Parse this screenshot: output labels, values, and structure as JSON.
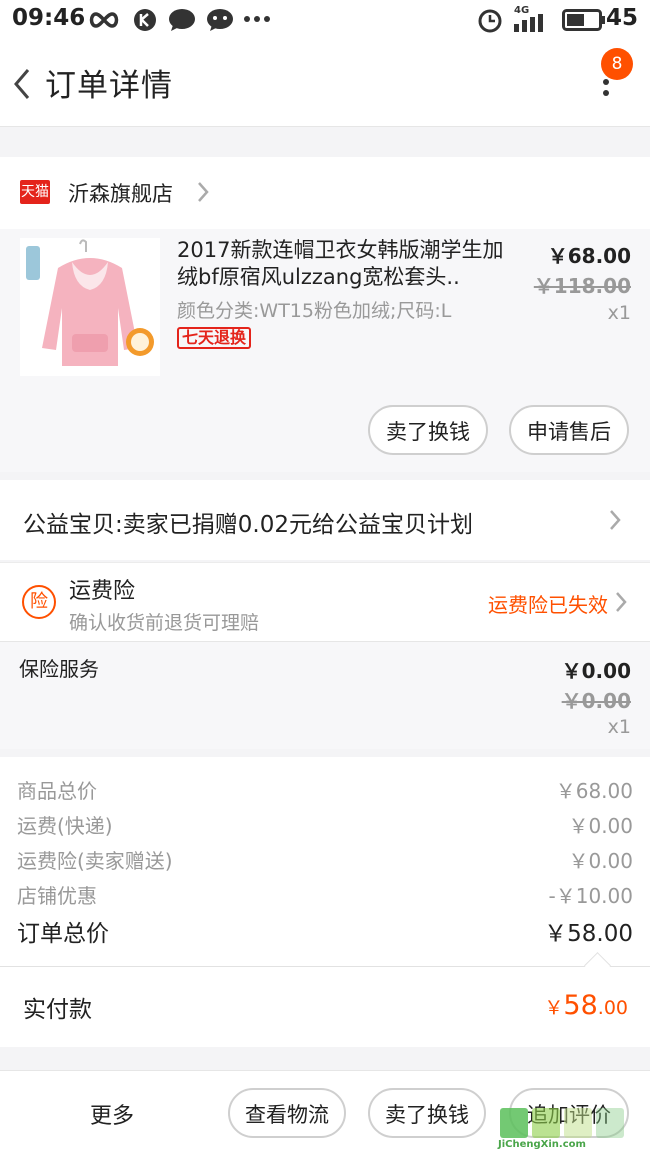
{
  "status_bar": {
    "time": "09:46",
    "icons": [
      "infinity-icon",
      "k-app-icon",
      "message-icon",
      "chat-icon",
      "more-dots-icon",
      "alarm-icon",
      "signal-4g-icon",
      "battery-icon"
    ],
    "network": "4G",
    "battery": "45"
  },
  "header": {
    "title": "订单详情",
    "badge_count": "8"
  },
  "shop": {
    "platform_label": "天猫",
    "name": "沂森旗舰店"
  },
  "product": {
    "title": "2017新款连帽卫衣女韩版潮学生加绒bf原宿风ulzzang宽松套头..",
    "spec": "颜色分类:WT15粉色加绒;尺码:L",
    "tag": "七天退换",
    "price": "￥68.00",
    "original_price": "￥118.00",
    "quantity": "x1",
    "buttons": {
      "sell_label": "卖了换钱",
      "after_sale_label": "申请售后"
    }
  },
  "charity": {
    "text": "公益宝贝:卖家已捐赠0.02元给公益宝贝计划"
  },
  "shipping_insurance": {
    "icon_label": "险",
    "title": "运费险",
    "subtitle": "确认收货前退货可理赔",
    "status": "运费险已失效"
  },
  "insurance_service": {
    "label": "保险服务",
    "price": "￥0.00",
    "original_price": "￥0.00",
    "quantity": "x1"
  },
  "summary": {
    "rows": [
      {
        "label": "商品总价",
        "value": "￥68.00"
      },
      {
        "label": "运费(快递)",
        "value": "￥0.00"
      },
      {
        "label": "运费险(卖家赠送)",
        "value": "￥0.00"
      },
      {
        "label": "店铺优惠",
        "value": "-￥10.00"
      }
    ],
    "total_label": "订单总价",
    "total_value": "￥58.00"
  },
  "payment": {
    "label": "实付款",
    "currency": "￥",
    "integer": "58",
    "decimal": ".00"
  },
  "bottom_bar": {
    "more_label": "更多",
    "logistics_label": "查看物流",
    "sell_label": "卖了换钱",
    "review_label": "追加评价"
  },
  "watermark": {
    "text": "JiChengXin.com"
  },
  "colors": {
    "accent": "#ff5000",
    "tmall_red": "#e4241b",
    "muted": "#999999"
  }
}
